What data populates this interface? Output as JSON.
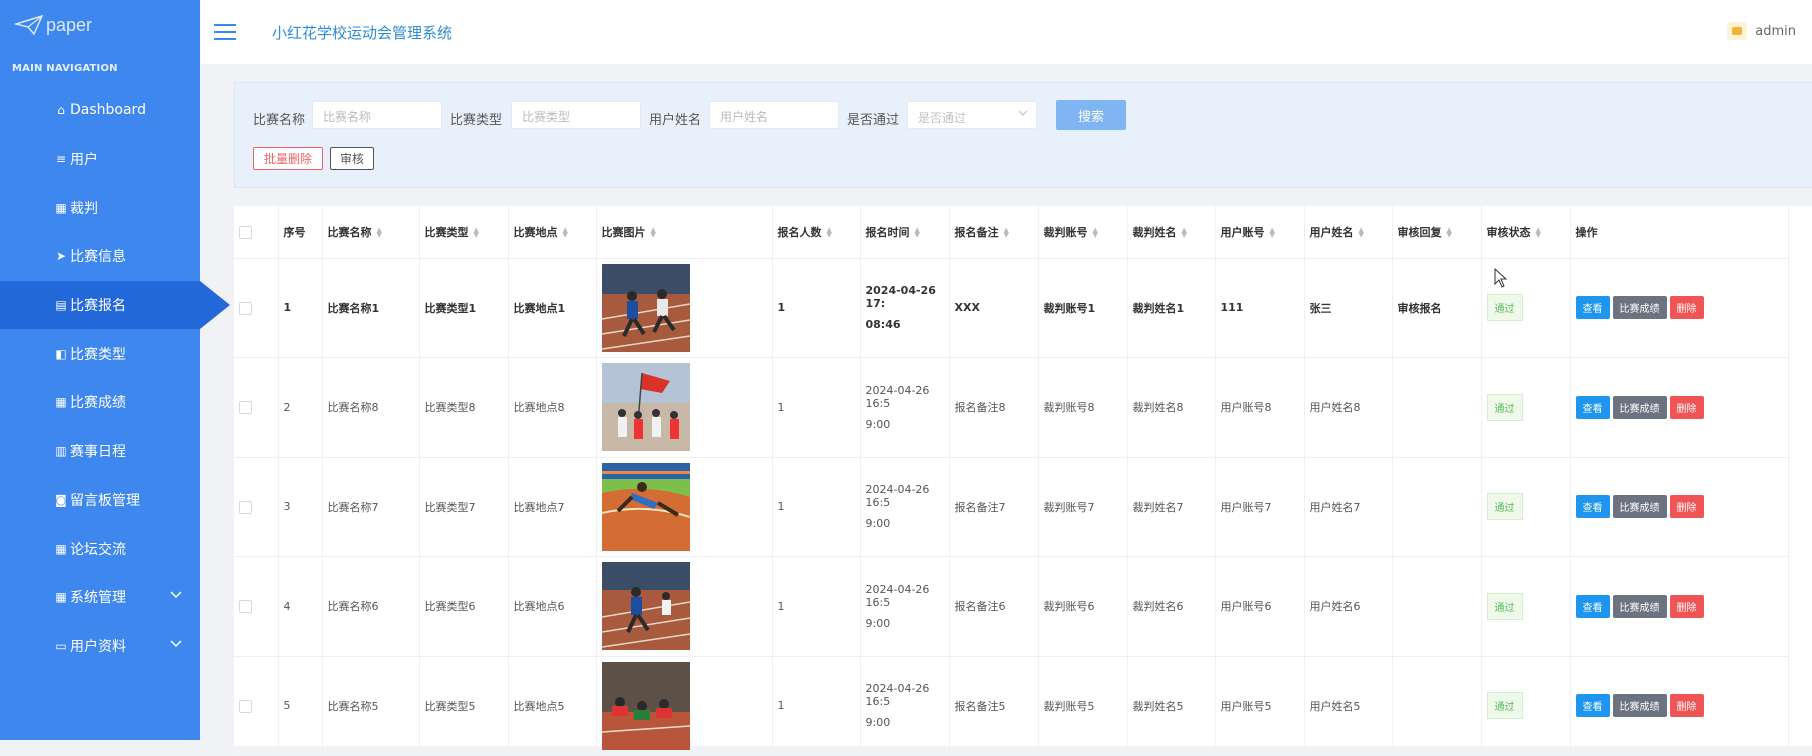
{
  "logo": {
    "text": "paper"
  },
  "nav": {
    "heading": "MAIN NAVIGATION",
    "items": [
      {
        "label": "Dashboard",
        "icon": "home-icon"
      },
      {
        "label": "用户",
        "icon": "list-icon"
      },
      {
        "label": "裁判",
        "icon": "grid-icon"
      },
      {
        "label": "比赛信息",
        "icon": "send-icon"
      },
      {
        "label": "比赛报名",
        "icon": "clipboard-icon"
      },
      {
        "label": "比赛类型",
        "icon": "book-icon"
      },
      {
        "label": "比赛成绩",
        "icon": "grid-icon"
      },
      {
        "label": "赛事日程",
        "icon": "bar-chart-icon"
      },
      {
        "label": "留言板管理",
        "icon": "chat-icon"
      },
      {
        "label": "论坛交流",
        "icon": "grid-icon"
      },
      {
        "label": "系统管理",
        "icon": "grid-icon"
      },
      {
        "label": "用户资料",
        "icon": "card-icon"
      }
    ]
  },
  "header": {
    "title": "小红花学校运动会管理系统",
    "user": "admin"
  },
  "search": {
    "f1": {
      "label": "比赛名称",
      "placeholder": "比赛名称"
    },
    "f2": {
      "label": "比赛类型",
      "placeholder": "比赛类型"
    },
    "f3": {
      "label": "用户姓名",
      "placeholder": "用户姓名"
    },
    "f4": {
      "label": "是否通过",
      "placeholder": "是否通过"
    },
    "button": "搜索",
    "batch_delete": "批量删除",
    "audit": "审核"
  },
  "table": {
    "columns": [
      "序号",
      "比赛名称",
      "比赛类型",
      "比赛地点",
      "比赛图片",
      "报名人数",
      "报名时间",
      "报名备注",
      "裁判账号",
      "裁判姓名",
      "用户账号",
      "用户姓名",
      "审核回复",
      "审核状态",
      "操作"
    ],
    "rows": [
      {
        "no": "1",
        "name": "比赛名称1",
        "type": "比赛类型1",
        "place": "比赛地点1",
        "count": "1",
        "time1": "2024-04-26 17:",
        "time2": "08:46",
        "note": "XXX",
        "ref_acc": "裁判账号1",
        "ref_name": "裁判姓名1",
        "user_acc": "111",
        "user_name": "张三",
        "reply": "审核报名",
        "status": "通过"
      },
      {
        "no": "2",
        "name": "比赛名称8",
        "type": "比赛类型8",
        "place": "比赛地点8",
        "count": "1",
        "time1": "2024-04-26 16:5",
        "time2": "9:00",
        "note": "报名备注8",
        "ref_acc": "裁判账号8",
        "ref_name": "裁判姓名8",
        "user_acc": "用户账号8",
        "user_name": "用户姓名8",
        "reply": "",
        "status": "通过"
      },
      {
        "no": "3",
        "name": "比赛名称7",
        "type": "比赛类型7",
        "place": "比赛地点7",
        "count": "1",
        "time1": "2024-04-26 16:5",
        "time2": "9:00",
        "note": "报名备注7",
        "ref_acc": "裁判账号7",
        "ref_name": "裁判姓名7",
        "user_acc": "用户账号7",
        "user_name": "用户姓名7",
        "reply": "",
        "status": "通过"
      },
      {
        "no": "4",
        "name": "比赛名称6",
        "type": "比赛类型6",
        "place": "比赛地点6",
        "count": "1",
        "time1": "2024-04-26 16:5",
        "time2": "9:00",
        "note": "报名备注6",
        "ref_acc": "裁判账号6",
        "ref_name": "裁判姓名6",
        "user_acc": "用户账号6",
        "user_name": "用户姓名6",
        "reply": "",
        "status": "通过"
      },
      {
        "no": "5",
        "name": "比赛名称5",
        "type": "比赛类型5",
        "place": "比赛地点5",
        "count": "1",
        "time1": "2024-04-26 16:5",
        "time2": "9:00",
        "note": "报名备注5",
        "ref_acc": "裁判账号5",
        "ref_name": "裁判姓名5",
        "user_acc": "用户账号5",
        "user_name": "用户姓名5",
        "reply": "",
        "status": "通过"
      }
    ],
    "actions": {
      "view": "查看",
      "score": "比赛成绩",
      "delete": "删除"
    }
  },
  "colors": {
    "sidebar": "#3e87ee",
    "active": "#2368d8",
    "view": "#1e96ef",
    "score": "#6b7280",
    "delete": "#f05555",
    "pass": "#5cb85c"
  }
}
